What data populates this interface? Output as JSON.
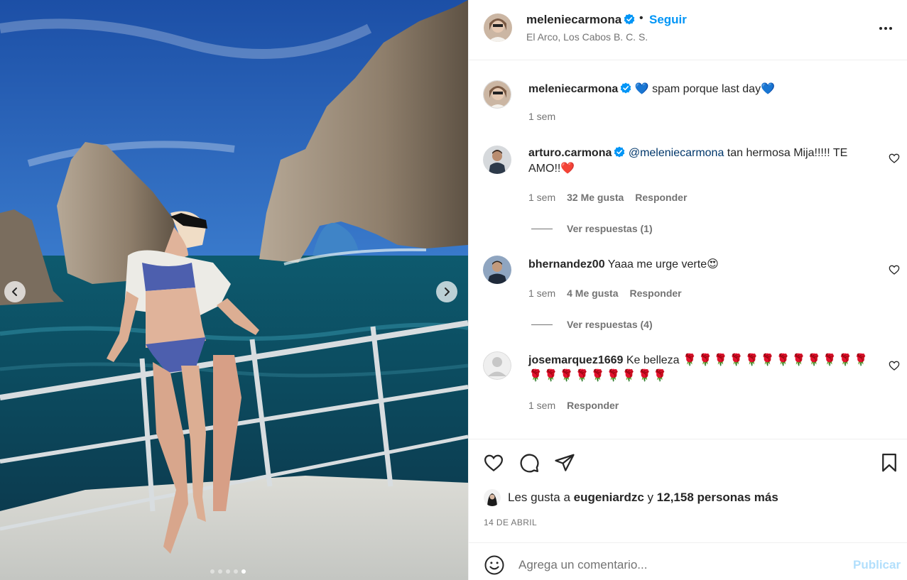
{
  "post": {
    "media": {
      "slide_index": 5,
      "slide_count": 5,
      "prev_icon": "chevron-left-icon",
      "next_icon": "chevron-right-icon"
    },
    "header": {
      "username": "meleniecarmona",
      "verified": true,
      "separator": "•",
      "follow_label": "Seguir",
      "location": "El Arco, Los Cabos B. C. S.",
      "more_icon": "more-options-icon"
    },
    "caption": {
      "username": "meleniecarmona",
      "verified": true,
      "text": "💙 spam porque last day💙",
      "time": "1 sem"
    },
    "comments": [
      {
        "username": "arturo.carmona",
        "verified": true,
        "mention": "@meleniecarmona",
        "text": " tan hermosa Mija!!!!! TE AMO!!❤️",
        "time": "1 sem",
        "likes": "32 Me gusta",
        "reply_label": "Responder",
        "view_replies": "Ver respuestas (1)"
      },
      {
        "username": "bhernandez00",
        "verified": false,
        "text": " Yaaa me urge verte😍",
        "time": "1 sem",
        "likes": "4 Me gusta",
        "reply_label": "Responder",
        "view_replies": "Ver respuestas (4)"
      },
      {
        "username": "josemarquez1669",
        "verified": false,
        "text": " Ke belleza ",
        "flowers": "🌹🌹🌹🌹🌹🌹🌹🌹🌹🌹🌹🌹🌹🌹🌹🌹🌹🌹🌹🌹🌹",
        "time": "1 sem",
        "reply_label": "Responder"
      }
    ],
    "actions": {
      "like_icon": "heart-icon",
      "comment_icon": "comment-icon",
      "share_icon": "paper-plane-icon",
      "save_icon": "bookmark-icon",
      "likes_prefix": "Les gusta a ",
      "likes_user": "eugeniardzc",
      "likes_middle": " y ",
      "likes_count": "12,158 personas más",
      "date": "14 DE ABRIL"
    },
    "add_comment": {
      "emoji_icon": "emoji-icon",
      "placeholder": "Agrega un comentario...",
      "publish_label": "Publicar"
    },
    "colors": {
      "accent": "#0095f6",
      "publish_disabled": "#b2dffc",
      "muted": "#737373",
      "mention": "#00376b",
      "border": "#efefef"
    }
  }
}
